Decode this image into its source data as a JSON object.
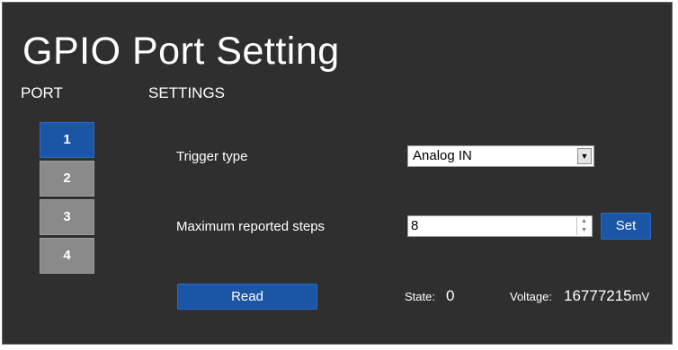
{
  "page": {
    "title": "GPIO Port Setting",
    "port_header": "PORT",
    "settings_header": "SETTINGS"
  },
  "ports": [
    {
      "label": "1",
      "active": true
    },
    {
      "label": "2",
      "active": false
    },
    {
      "label": "3",
      "active": false
    },
    {
      "label": "4",
      "active": false
    }
  ],
  "settings": {
    "trigger_type_label": "Trigger type",
    "trigger_type_value": "Analog IN",
    "max_steps_label": "Maximum reported steps",
    "max_steps_value": "8",
    "set_label": "Set",
    "read_label": "Read",
    "state_label": "State:",
    "state_value": "0",
    "voltage_label": "Voltage:",
    "voltage_value": "16777215",
    "voltage_unit": "mV"
  },
  "colors": {
    "panel_bg": "#2f2f2f",
    "accent_blue": "#1b56a6",
    "inactive_gray": "#8a8a8a"
  },
  "icons": {
    "select_arrow": "dropdown-arrow-icon",
    "spinner": "stepper-icon"
  }
}
